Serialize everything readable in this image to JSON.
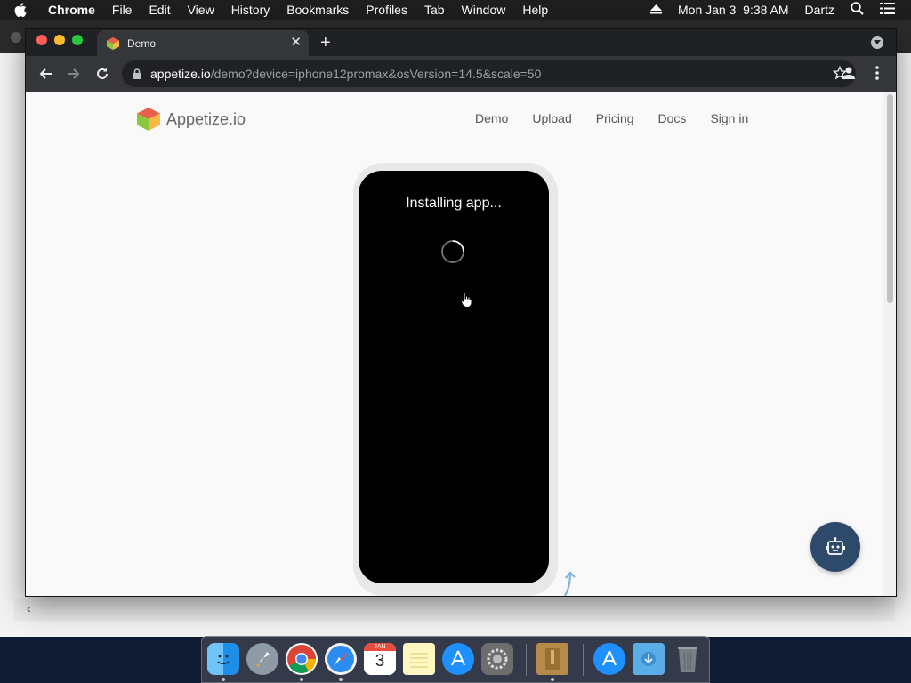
{
  "menubar": {
    "app_name": "Chrome",
    "items": [
      "File",
      "Edit",
      "View",
      "History",
      "Bookmarks",
      "Profiles",
      "Tab",
      "Window",
      "Help"
    ],
    "datetime": "Mon Jan 3  9:38 AM",
    "user": "Dartz"
  },
  "browser": {
    "tab_title": "Demo",
    "url_host": "appetize.io",
    "url_path": "/demo?device=iphone12promax&osVersion=14.5&scale=50"
  },
  "site": {
    "logo_text": "Appetize.io",
    "nav": [
      "Demo",
      "Upload",
      "Pricing",
      "Docs",
      "Sign in"
    ]
  },
  "device": {
    "status_text": "Installing app..."
  },
  "dock": {
    "calendar_month": "JAN",
    "calendar_day": "3",
    "apps": [
      "finder-icon",
      "launchpad-icon",
      "chrome-icon",
      "safari-icon",
      "calendar-icon",
      "notes-icon",
      "app-store-icon",
      "system-preferences-icon",
      "archive-icon",
      "app-store-folder-icon",
      "downloads-folder-icon",
      "trash-icon"
    ]
  }
}
